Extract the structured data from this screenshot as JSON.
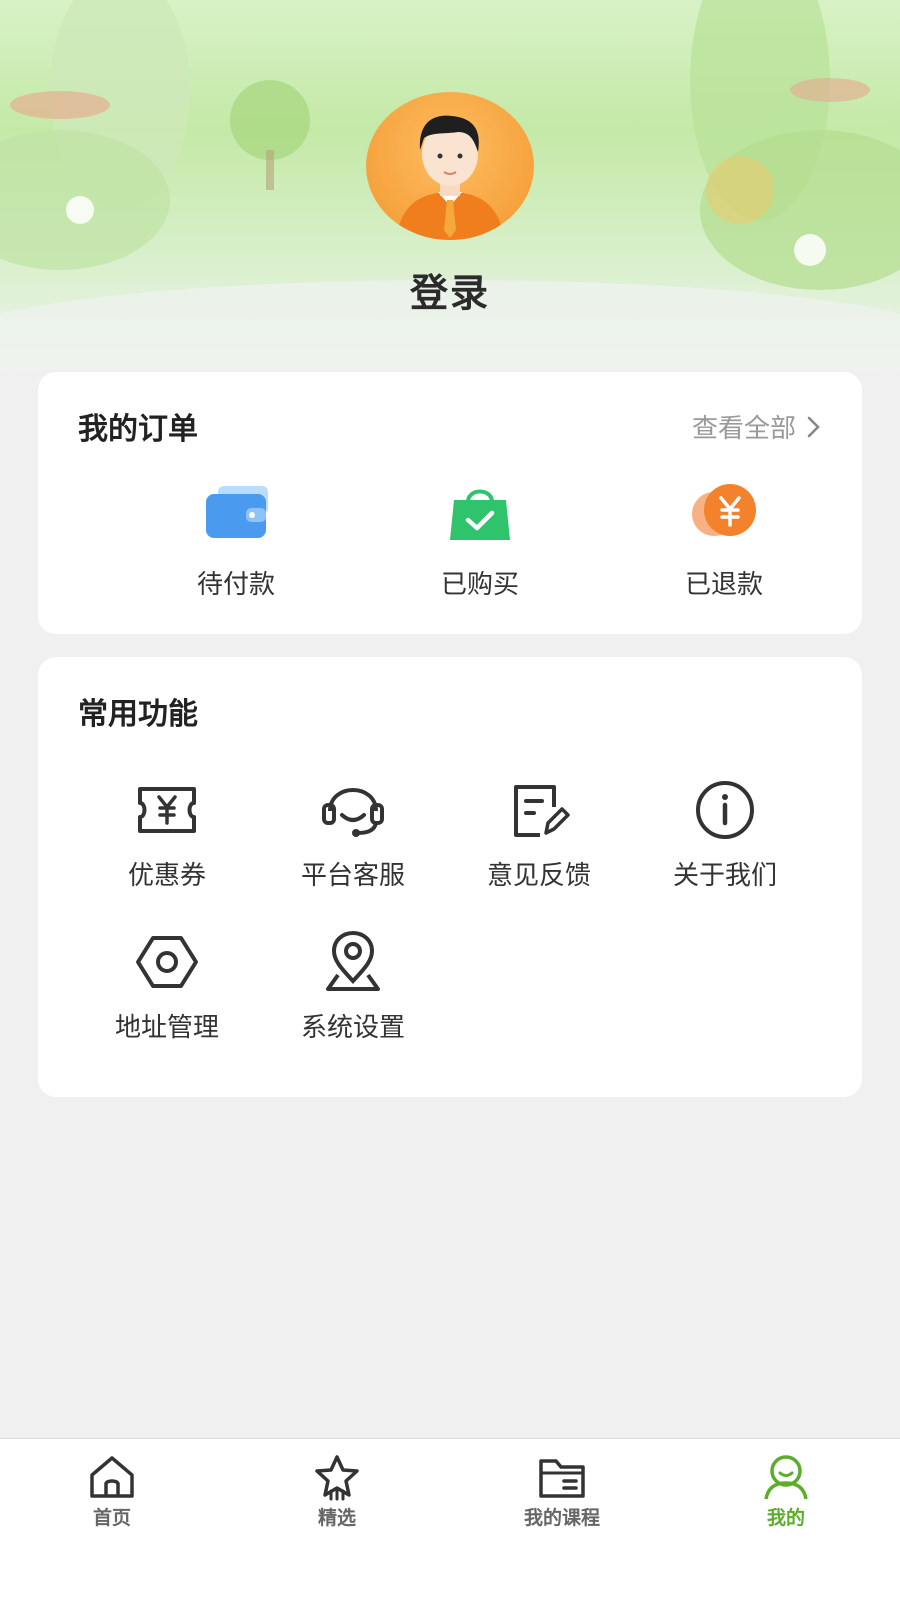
{
  "profile": {
    "login_label": "登录"
  },
  "orders": {
    "title": "我的订单",
    "see_all": "查看全部",
    "items": [
      {
        "label": "待付款",
        "icon": "wallet-icon",
        "color": "#4a9bef"
      },
      {
        "label": "已购买",
        "icon": "shopping-bag-icon",
        "color": "#2fc46c"
      },
      {
        "label": "已退款",
        "icon": "refund-yuan-icon",
        "color": "#f4822d"
      }
    ]
  },
  "features": {
    "title": "常用功能",
    "items": [
      {
        "label": "优惠券",
        "icon": "coupon-icon"
      },
      {
        "label": "平台客服",
        "icon": "headset-icon"
      },
      {
        "label": "意见反馈",
        "icon": "feedback-icon"
      },
      {
        "label": "关于我们",
        "icon": "info-icon"
      },
      {
        "label": "地址管理",
        "icon": "hexagon-nut-icon"
      },
      {
        "label": "系统设置",
        "icon": "location-pin-icon"
      }
    ]
  },
  "tabbar": {
    "items": [
      {
        "label": "首页",
        "icon": "home-icon",
        "active": false
      },
      {
        "label": "精选",
        "icon": "star-icon",
        "active": false
      },
      {
        "label": "我的课程",
        "icon": "folder-icon",
        "active": false
      },
      {
        "label": "我的",
        "icon": "user-icon",
        "active": true
      }
    ],
    "active_color": "#5aae2a",
    "inactive_color": "#333333"
  }
}
